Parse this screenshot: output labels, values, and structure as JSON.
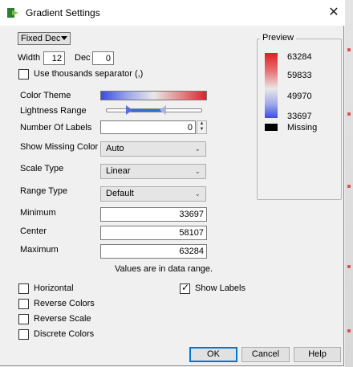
{
  "window": {
    "title": "Gradient Settings",
    "close_glyph": "✕"
  },
  "format": {
    "selected": "Fixed Dec",
    "width_label": "Width",
    "width_value": "12",
    "dec_label": "Dec",
    "dec_value": "0"
  },
  "thousands": {
    "label": "Use thousands separator (,)",
    "checked": false
  },
  "color_theme": {
    "label": "Color Theme"
  },
  "lightness": {
    "label": "Lightness Range",
    "range_fraction": [
      0.25,
      0.55
    ]
  },
  "labels_count": {
    "label": "Number Of Labels",
    "value": "0"
  },
  "missing_color": {
    "label": "Show Missing Color",
    "value": "Auto"
  },
  "scale_type": {
    "label": "Scale Type",
    "value": "Linear"
  },
  "range_type": {
    "label": "Range Type",
    "value": "Default"
  },
  "minimum": {
    "label": "Minimum",
    "value": "33697"
  },
  "center": {
    "label": "Center",
    "value": "58107"
  },
  "maximum": {
    "label": "Maximum",
    "value": "63284"
  },
  "range_note": "Values are in data range.",
  "checkboxes": {
    "horizontal": {
      "label": "Horizontal",
      "checked": false
    },
    "reverse_colors": {
      "label": "Reverse Colors",
      "checked": false
    },
    "reverse_scale": {
      "label": "Reverse Scale",
      "checked": false
    },
    "discrete_colors": {
      "label": "Discrete Colors",
      "checked": false
    },
    "show_labels": {
      "label": "Show Labels",
      "checked": true
    }
  },
  "preview": {
    "title": "Preview",
    "ticks": [
      "63284",
      "59833",
      "49970",
      "33697"
    ],
    "missing_label": "Missing"
  },
  "buttons": {
    "ok": "OK",
    "cancel": "Cancel",
    "help": "Help"
  },
  "colors": {
    "low": "#3b4cde",
    "mid": "#e8e8e8",
    "high": "#e11d23",
    "slider": "#2f6fd0"
  }
}
